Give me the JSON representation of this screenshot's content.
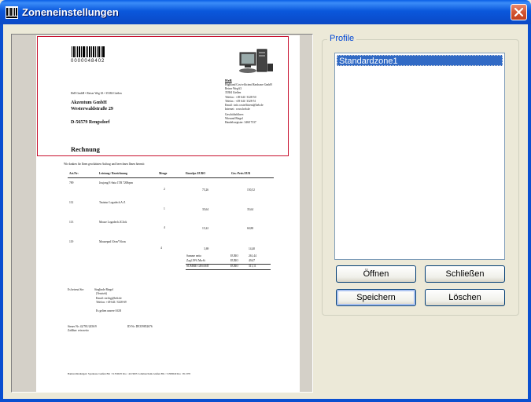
{
  "window": {
    "title": "Zoneneinstellungen",
    "icon": "barcode-window-icon",
    "title_color": "#0a4fd0"
  },
  "preview": {
    "barcode_number": "0000048402",
    "sender_line": "HeB GmbH • Reiser Weg 63 • 35384 Gießen",
    "recipient": {
      "name": "Akzentum GmbH",
      "street": "Westerwaldstraße 29",
      "city": "D-56579 Rengsdorf"
    },
    "company": {
      "name": "HeB",
      "subtitle": "Highland Cost-efficient Hardware GmbH",
      "street": "Reiser Weg 63",
      "city": "35384 Gießen",
      "phone": "Telefon  : +49 641/ 3328-50",
      "fax": "Telefax  : +49 641/ 3328-51",
      "email": "Email    : info.costefficient@heb.de",
      "internet": "Internet : www.heb.de",
      "manager_label": "Geschäftsführer:",
      "manager": "Wiesand Biegel",
      "register": "Handelsregister: 3468 7537"
    },
    "doc_title": "Rechnung",
    "intro": "Wir danken für Ihren geschätzten Auftrag und berechnen Ihnen hiermit:",
    "columns": [
      "Art.Nr:",
      "Leistung / Bezeichnung",
      "Menge",
      "Einzelpr. EURO",
      "Ges.-Preis EUR"
    ],
    "rows": [
      {
        "art": "789",
        "desc": "Joujong E-Sata 1TB 7200rpm",
        "qty": "2",
        "unit": "75,26",
        "total": "150,52"
      },
      {
        "art": "112",
        "desc": "Tastatur Logadech A-Z",
        "qty": "1",
        "unit": "35,64",
        "total": "35,64"
      },
      {
        "art": "113",
        "desc": "Mouse Logadech 2Click",
        "qty": "4",
        "unit": "15,22",
        "total": "60,88"
      },
      {
        "art": "119",
        "desc": "Mousepad 10cm*16cm",
        "qty": "4",
        "unit": "3,69",
        "total": "14,40"
      }
    ],
    "totals": [
      {
        "label": "Summe netto",
        "currency": "EURO",
        "value": "261,44"
      },
      {
        "label": "Zzgl.19% MwSt",
        "currency": "EURO",
        "value": "49,67"
      },
      {
        "label": "SUMME GESAMT",
        "currency": "EURO",
        "value": "311,11"
      }
    ],
    "contact": {
      "label": "Es betreut Sie:",
      "name": "Sieglinde Biegel",
      "role": "(Vertrieb)",
      "email": "Email: sie.big@heb.de",
      "phone": "Telefon: +49 641/ 3328-69"
    },
    "agb": "Es gelten unsere AGB",
    "tax": "Steuer Nr: 42/781/2456/9",
    "vat": "ID-Nr: DE359852676",
    "payment": "Zahlbar: rein netto",
    "footer": "Bankverbindungen: Sparkasse Gießen Blz : 51350025 Kto : 4213003 Commerzbank Gießen Blz : 51380040 Kto : 811378"
  },
  "profiles": {
    "group_label": "Profile",
    "items": [
      "Standardzone1"
    ],
    "selected_color": "#316ac5"
  },
  "buttons": {
    "open": "Öffnen",
    "close": "Schließen",
    "save": "Speichern",
    "delete": "Löschen"
  }
}
